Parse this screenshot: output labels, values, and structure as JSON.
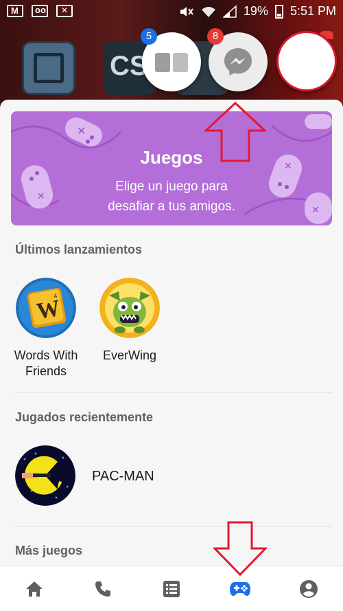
{
  "status_bar": {
    "battery_percent": "19%",
    "time": "5:51 PM",
    "notification_icons": [
      "gmail-icon",
      "voicemail-icon",
      "missed-notification-icon"
    ],
    "system_icons": [
      "mute-icon",
      "wifi-icon",
      "signal-icon",
      "battery-icon"
    ]
  },
  "background": {
    "app_text": "CS"
  },
  "chat_heads": [
    {
      "name": "cards-head",
      "badge": "5",
      "badge_color": "#1d6fe8"
    },
    {
      "name": "messenger-head",
      "badge": "8",
      "badge_color": "#e53935"
    },
    {
      "name": "contact-head",
      "highlight_color": "#d6182c"
    }
  ],
  "banner": {
    "title": "Juegos",
    "subtitle_line1": "Elige un juego para",
    "subtitle_line2": "desafiar a tus amigos.",
    "color": "#b46ed8"
  },
  "sections": {
    "latest": {
      "title": "Últimos lanzamientos",
      "games": [
        {
          "label_line1": "Words With",
          "label_line2": "Friends"
        },
        {
          "label_line1": "EverWing",
          "label_line2": ""
        }
      ]
    },
    "recent": {
      "title": "Jugados recientemente",
      "games": [
        {
          "label": "PAC-MAN"
        }
      ]
    },
    "more": {
      "title": "Más juegos"
    }
  },
  "bottom_nav": {
    "items": [
      {
        "icon": "home-icon",
        "active": false
      },
      {
        "icon": "phone-icon",
        "active": false
      },
      {
        "icon": "list-icon",
        "active": false
      },
      {
        "icon": "gamepad-icon",
        "active": true
      },
      {
        "icon": "profile-icon",
        "active": false
      }
    ],
    "active_color": "#1d6fe8",
    "inactive_color": "#5f5f5f"
  },
  "annotation_color": "#e5182c"
}
